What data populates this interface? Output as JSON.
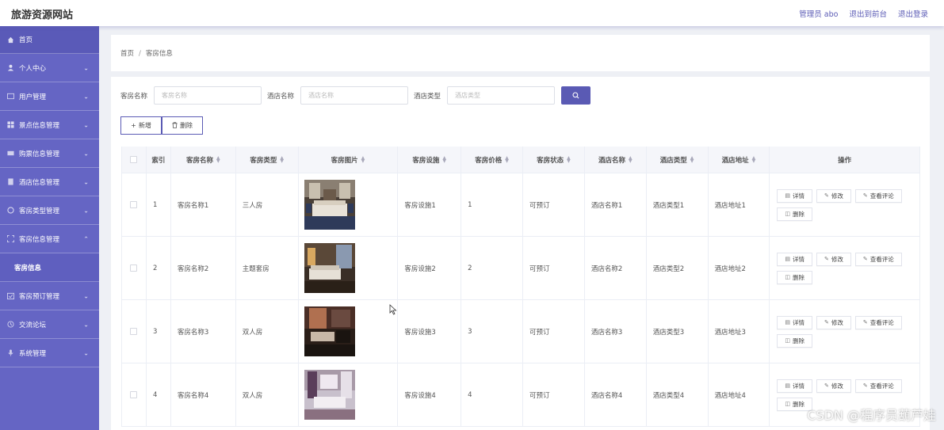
{
  "header": {
    "brand": "旅游资源网站",
    "admin": "管理员 abo",
    "to_front": "退出到前台",
    "logout": "退出登录"
  },
  "sidebar": {
    "items": [
      {
        "label": "首页",
        "icon": "home-icon",
        "expandable": false
      },
      {
        "label": "个人中心",
        "icon": "user-icon",
        "expandable": true
      },
      {
        "label": "用户管理",
        "icon": "users-icon",
        "expandable": true
      },
      {
        "label": "景点信息管理",
        "icon": "grid-icon",
        "expandable": true
      },
      {
        "label": "购票信息管理",
        "icon": "ticket-icon",
        "expandable": true
      },
      {
        "label": "酒店信息管理",
        "icon": "building-icon",
        "expandable": true
      },
      {
        "label": "客房类型管理",
        "icon": "tag-icon",
        "expandable": true
      },
      {
        "label": "客房信息管理",
        "icon": "expand-icon",
        "expandable": true,
        "expanded": true
      },
      {
        "label": "客房预订管理",
        "icon": "calendar-icon",
        "expandable": true
      },
      {
        "label": "交流论坛",
        "icon": "chat-icon",
        "expandable": true
      },
      {
        "label": "系统管理",
        "icon": "mic-icon",
        "expandable": true
      }
    ],
    "sub_item": "客房信息"
  },
  "breadcrumb": {
    "home": "首页",
    "separator": "/",
    "current": "客房信息"
  },
  "search": {
    "room_name_label": "客房名称",
    "room_name_placeholder": "客房名称",
    "hotel_name_label": "酒店名称",
    "hotel_name_placeholder": "酒店名称",
    "hotel_type_label": "酒店类型",
    "hotel_type_placeholder": "酒店类型"
  },
  "toolbar": {
    "add": "新增",
    "delete": "删除"
  },
  "table": {
    "headers": [
      "索引",
      "客房名称",
      "客房类型",
      "客房图片",
      "客房设施",
      "客房价格",
      "客房状态",
      "酒店名称",
      "酒店类型",
      "酒店地址",
      "操作"
    ],
    "rows": [
      {
        "index": "1",
        "room_name": "客房名称1",
        "room_type": "三人房",
        "facilities": "客房设施1",
        "price": "1",
        "status": "可预订",
        "hotel_name": "酒店名称1",
        "hotel_type": "酒店类型1",
        "hotel_address": "酒店地址1"
      },
      {
        "index": "2",
        "room_name": "客房名称2",
        "room_type": "主题套房",
        "facilities": "客房设施2",
        "price": "2",
        "status": "可预订",
        "hotel_name": "酒店名称2",
        "hotel_type": "酒店类型2",
        "hotel_address": "酒店地址2"
      },
      {
        "index": "3",
        "room_name": "客房名称3",
        "room_type": "双人房",
        "facilities": "客房设施3",
        "price": "3",
        "status": "可预订",
        "hotel_name": "酒店名称3",
        "hotel_type": "酒店类型3",
        "hotel_address": "酒店地址3"
      },
      {
        "index": "4",
        "room_name": "客房名称4",
        "room_type": "双人房",
        "facilities": "客房设施4",
        "price": "4",
        "status": "可预订",
        "hotel_name": "酒店名称4",
        "hotel_type": "酒店类型4",
        "hotel_address": "酒店地址4"
      }
    ],
    "actions": {
      "detail": "详情",
      "edit": "修改",
      "comments": "查看评论",
      "delete": "删除"
    }
  },
  "watermark": "CSDN @程序员葫芦娃",
  "colors": {
    "accent": "#5a5ab4",
    "sidebar": "#6565c4",
    "page_bg": "#eef0f5"
  }
}
